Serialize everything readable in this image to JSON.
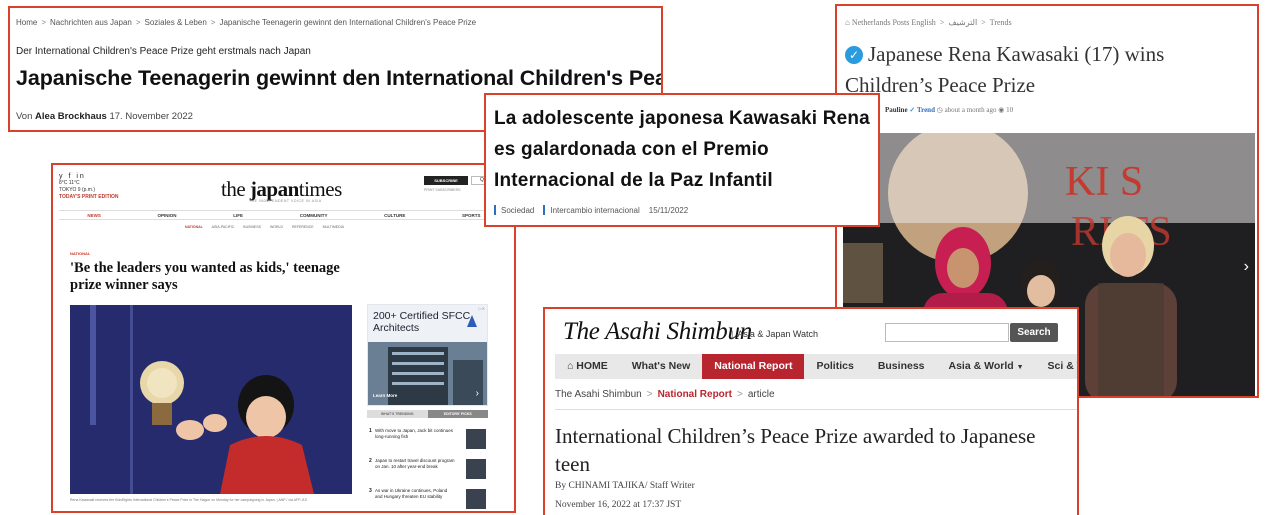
{
  "german": {
    "breadcrumbs": [
      "Home",
      "Nachrichten aus Japan",
      "Soziales & Leben",
      "Japanische Teenagerin gewinnt den International Children's Peace Prize"
    ],
    "separator": ">",
    "kicker": "Der International Children's Peace Prize geht erstmals nach Japan",
    "headline": "Japanische Teenagerin gewinnt den International Children's Peace Prize",
    "byline_prefix": "Von",
    "author": "Alea Brockhaus",
    "date": "17. November 2022"
  },
  "netherlands": {
    "breadcrumbs": [
      "Netherlands Posts English",
      "الترشيف",
      "Trends"
    ],
    "separator": ">",
    "headline": "Japanese Rena Kawasaki (17) wins Children’s Peace Prize",
    "author": "Pauline",
    "category": "Trend",
    "time": "about a month ago",
    "views": "10",
    "photo_banner_text": "KI S RIGHTS"
  },
  "spanish": {
    "headline": "La adolescente japonesa Kawasaki Rena es galardonada con el Premio Internacional de la Paz Infantil",
    "tags": [
      "Sociedad",
      "Intercambio internacional"
    ],
    "date": "15/11/2022"
  },
  "japantimes": {
    "social_icons": "y f in",
    "weather": "8°C 11°C",
    "location": "TOKYO 9 (p.m.)",
    "edition": "TODAY'S PRINT EDITION",
    "logo_pre": "the ",
    "logo_bold": "japan",
    "logo_post": "times",
    "tagline": "THE INDEPENDENT VOICE IN ASIA",
    "subscribe": "SUBSCRIBE",
    "search": "Q",
    "subscribe_note": "PRINT SUBSCRIBERS",
    "nav": [
      "NEWS",
      "OPINION",
      "LIFE",
      "COMMUNITY",
      "CULTURE",
      "SPORTS"
    ],
    "subnav": [
      "NATIONAL",
      "ASIA-PACIFIC",
      "BUSINESS",
      "WORLD",
      "REFERENCE",
      "MULTIMEDIA"
    ],
    "section": "NATIONAL",
    "headline": "'Be the leaders you wanted as kids,' teenage prize winner says",
    "caption": "Rena Kawasaki receives the KidsRights International Children's Peace Prize in The Hague on Monday for her campaigning in Japan. | ANP / via AFP-JIJI",
    "ad_text": "200+ Certified SFCC Architects",
    "ad_flag": "▷✕",
    "ad_cta": "Learn More",
    "tabs": [
      "WHAT'S TRENDING",
      "EDITORS' PICKS"
    ],
    "trending": [
      {
        "num": "1",
        "text": "With move to Japan, Jack bit continues long-running fish"
      },
      {
        "num": "2",
        "text": "Japan to restart travel discount program on Jan. 10 after year-end break"
      },
      {
        "num": "3",
        "text": "As war in Ukraine continues, Poland and Hungary threaten EU stability"
      }
    ]
  },
  "asahi": {
    "logo": "The Asahi Shimbun",
    "subtitle": "Asia & Japan Watch",
    "search_button": "Search",
    "nav": [
      "HOME",
      "What's New",
      "National Report",
      "Politics",
      "Business",
      "Asia & World",
      "Sci & Tech"
    ],
    "breadcrumbs": [
      "The Asahi Shimbun",
      "National Report",
      "article"
    ],
    "separator": ">",
    "headline": "International Children’s Peace Prize awarded to Japanese teen",
    "byline": "By CHINAMI TAJIKA/ Staff Writer",
    "date": "November 16, 2022 at 17:37 JST"
  },
  "colors": {
    "frame": "#d9412b",
    "asahi_red": "#b8252f",
    "check_blue": "#2b9be0"
  }
}
